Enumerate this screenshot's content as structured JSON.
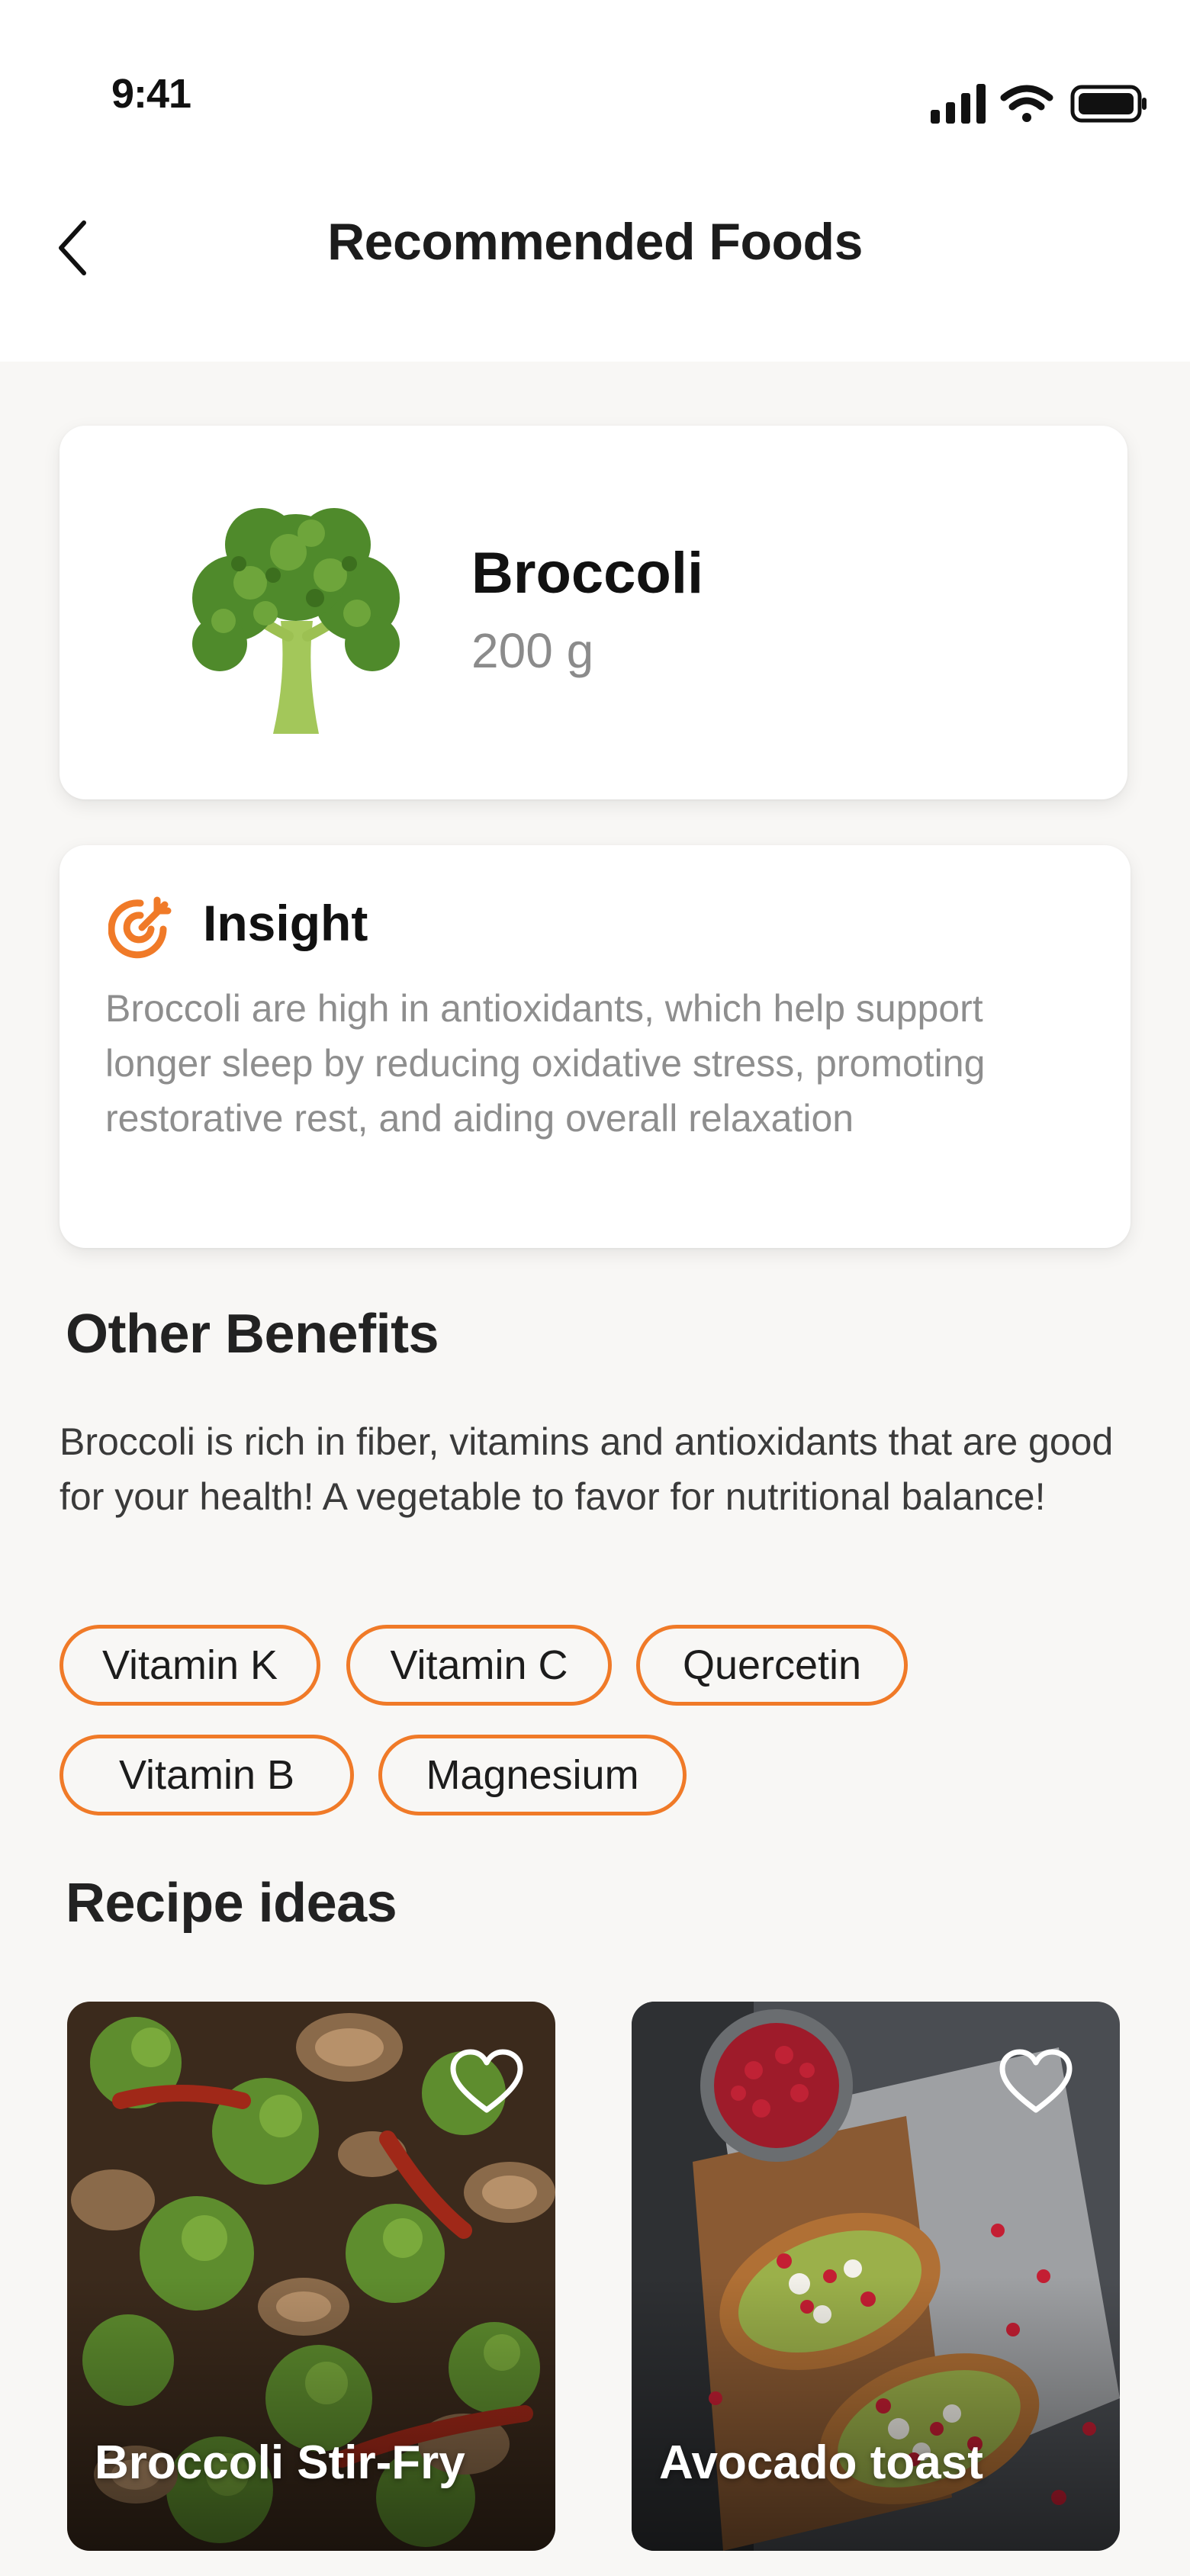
{
  "status_bar": {
    "time": "9:41",
    "icons": [
      "signal-icon",
      "wifi-icon",
      "battery-icon"
    ]
  },
  "header": {
    "title": "Recommended Foods",
    "back_icon": "chevron-left-icon"
  },
  "food": {
    "name": "Broccoli",
    "amount": "200 g",
    "image": "broccoli-image"
  },
  "insight": {
    "title": "Insight",
    "icon": "target-icon",
    "text": "Broccoli are high in antioxidants, which help support longer sleep by reducing oxidative stress, promoting restorative rest, and aiding overall relaxation"
  },
  "benefits": {
    "heading": "Other Benefits",
    "text": "Broccoli is rich in fiber, vitamins and antioxidants that are good for your health! A vegetable to favor for nutritional balance!",
    "tags": [
      "Vitamin K",
      "Vitamin C",
      "Quercetin",
      "Vitamin B",
      "Magnesium"
    ]
  },
  "recipes": {
    "heading": "Recipe ideas",
    "items": [
      {
        "title": "Broccoli Stir-Fry",
        "favorite_icon": "heart-icon"
      },
      {
        "title": "Avocado toast",
        "favorite_icon": "heart-icon"
      }
    ]
  },
  "colors": {
    "accent": "#f07a28",
    "background": "#f8f7f5",
    "card": "#ffffff",
    "muted_text": "#8e8e8e"
  }
}
